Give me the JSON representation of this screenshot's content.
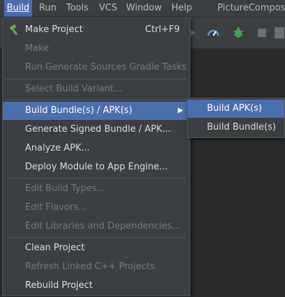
{
  "menubar": {
    "items": [
      {
        "label": "Build",
        "mnemonic": "B"
      },
      {
        "label": "Run",
        "mnemonic": "u"
      },
      {
        "label": "Tools",
        "mnemonic": "T"
      },
      {
        "label": "VCS",
        "mnemonic": "S"
      },
      {
        "label": "Window",
        "mnemonic": "W"
      },
      {
        "label": "Help",
        "mnemonic": "H"
      }
    ],
    "project_title": "PictureCompose"
  },
  "build_menu": {
    "items": [
      {
        "label": "Make Project",
        "shortcut": "Ctrl+F9"
      },
      {
        "label": "Make"
      },
      {
        "label": "Run Generate Sources Gradle Tasks"
      },
      {
        "label": "Select Build Variant..."
      },
      {
        "label": "Build Bundle(s) / APK(s)"
      },
      {
        "label": "Generate Signed Bundle / APK..."
      },
      {
        "label": "Analyze APK..."
      },
      {
        "label": "Deploy Module to App Engine..."
      },
      {
        "label": "Edit Build Types..."
      },
      {
        "label": "Edit Flavors..."
      },
      {
        "label": "Edit Libraries and Dependencies..."
      },
      {
        "label": "Clean Project"
      },
      {
        "label": "Refresh Linked C++ Projects"
      },
      {
        "label": "Rebuild Project"
      }
    ]
  },
  "submenu": {
    "items": [
      {
        "label": "Build APK(s)"
      },
      {
        "label": "Build Bundle(s)"
      }
    ]
  },
  "colors": {
    "selection": "#4b6eaf",
    "menu_bg": "#3c3f41",
    "editor_bg": "#2b2b2b"
  }
}
